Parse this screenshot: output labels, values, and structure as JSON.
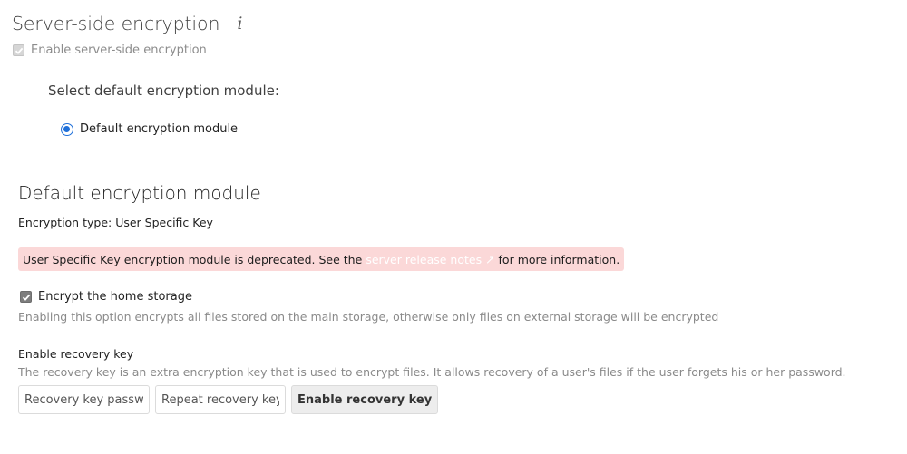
{
  "header": {
    "title": "Server-side encryption",
    "info_icon": "i"
  },
  "sse": {
    "enable_label": "Enable server-side encryption",
    "enabled": true,
    "select_module_label": "Select default encryption module:",
    "modules": [
      {
        "label": "Default encryption module",
        "selected": true
      }
    ]
  },
  "module": {
    "title": "Default encryption module",
    "encryption_type": "Encryption type: User Specific Key",
    "warning": {
      "text_before": "User Specific Key encryption module is deprecated. See the",
      "link_text": "server release notes ↗",
      "text_after": "for more information."
    },
    "encrypt_home": {
      "label": "Encrypt the home storage",
      "checked": true,
      "description": "Enabling this option encrypts all files stored on the main storage, otherwise only files on external storage will be encrypted"
    },
    "recovery": {
      "label": "Enable recovery key",
      "description": "The recovery key is an extra encryption key that is used to encrypt files. It allows recovery of a user's files if the user forgets his or her password.",
      "password_placeholder": "Recovery key password",
      "repeat_placeholder": "Repeat recovery key password",
      "button_label": "Enable recovery key"
    }
  },
  "colors": {
    "warning_bg": "#fbd8d8",
    "radio_accent": "#1e6fd9"
  }
}
